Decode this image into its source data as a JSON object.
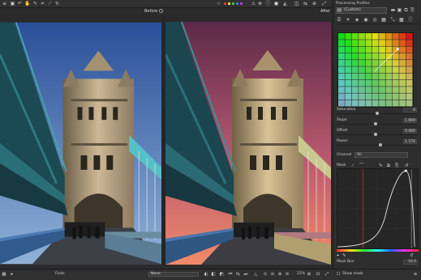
{
  "toolbar": {
    "icons": [
      "menu-icon",
      "save-icon",
      "undo-icon",
      "redo-icon",
      "hand-icon",
      "crop-icon",
      "straighten-icon",
      "rotate-icon",
      "wb-picker-icon"
    ],
    "right_icons": [
      "rank-star-icon",
      "warning-icon",
      "reject-icon",
      "color-label-icon",
      "info-icon",
      "histogram-icon",
      "before-after-icon",
      "flip-icon",
      "navigator-icon",
      "fullscreen-icon"
    ],
    "label_swatches": [
      "#d93a3a",
      "#e8d23a",
      "#3ac23a",
      "#3a7ad9",
      "#b03ad9"
    ]
  },
  "compare": {
    "before_label": "Before",
    "after_label": "After"
  },
  "panel": {
    "title": "Processing Profiles",
    "profile_value": "(Custom)",
    "sliders": [
      {
        "label": "Saturation",
        "value": "0",
        "level": 0.5
      },
      {
        "label": "Slope",
        "value": "1.000",
        "level": 0.48
      },
      {
        "label": "Offset",
        "value": "0.000",
        "level": 0.48
      },
      {
        "label": "Power",
        "value": "1.570",
        "level": 0.55
      }
    ],
    "channel_label": "Channel",
    "channel_value": "All",
    "mask_label": "Mask",
    "mask_blur_label": "Mask Blur",
    "mask_blur_value": "10.0"
  },
  "bottom": {
    "left_label": "Finds",
    "center_label": "None",
    "zoom_value": "22%",
    "show_mask_label": "Show mask"
  },
  "colors": {
    "ui_bg": "#2b2b2b",
    "panel_bg": "#2e2e2e"
  }
}
